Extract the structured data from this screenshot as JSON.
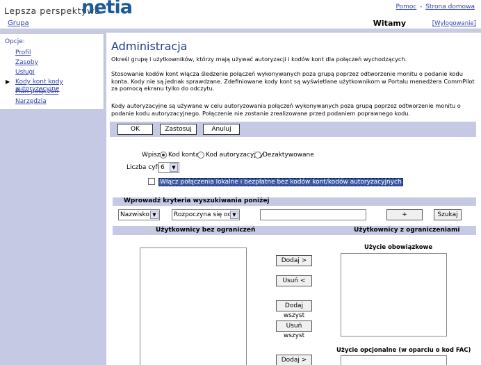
{
  "header": {
    "tagline": "Lepsza perspektywa",
    "brand": "netia",
    "help_link": "Pomoc",
    "separator": "-",
    "home_link": "Strona domowa",
    "group_link": "Grupa",
    "welcome": "Witamy",
    "logout": "[Wylogowanie]"
  },
  "sidebar": {
    "options_label": "Opcje:",
    "items": [
      {
        "label": "Profil"
      },
      {
        "label": "Zasoby"
      },
      {
        "label": "Usługi"
      },
      {
        "label": "Kody kont kody autoryzacyjne",
        "active": true
      },
      {
        "label": "Plan połączeń"
      },
      {
        "label": "Narzędzia"
      }
    ]
  },
  "main": {
    "title": "Administracja",
    "para1": "Określ grupę i użytkowników, którzy mają używać autoryzacji i kodów kont dla połączeń wychodzących.",
    "para2": "Stosowanie kodów kont włącza śledzenie połączeń wykonywanych poza grupą poprzez odtworzenie monitu o podanie kodu konta. Kody nie są jednak sprawdzane. Zdefiniowane kody kont są wyświetlane użytkownikom w Portalu menedżera CommPilot za pomocą ekranu tylko do odczytu.",
    "para3": "Kody autoryzacyjne są używane w celu autoryzowania połączeń wykonywanych poza grupą poprzez odtworzenie monitu o podanie kodu autoryzacyjnego. Połączenie nie zostanie zrealizowane przed podaniem poprawnego kodu."
  },
  "toolbar": {
    "ok": "OK",
    "apply": "Zastosuj",
    "cancel": "Anuluj"
  },
  "settings": {
    "enter_label": "Wpisz:",
    "radio_account": "Kod konta",
    "radio_auth": "Kod autoryzacyjny",
    "radio_disabled": "Dezaktywowane",
    "selected_radio": "Kod konta",
    "digits_label": "Liczba cyfr:",
    "digits_value": "6",
    "checkbox_label": "Włącz połączenia lokalne i bezpłatne bez kodów kont/kodów autoryzacyjnych",
    "checkbox_checked": false
  },
  "search": {
    "title": "Wprowadź kryteria wyszukiwania poniżej",
    "field_value": "Nazwisko",
    "mode_value": "Rozpoczyna się od",
    "text_value": "",
    "plus": "+",
    "search_button": "Szukaj"
  },
  "lists": {
    "left_header": "Użytkownicy bez ograniczeń",
    "right_header": "Użytkownicy z ograniczeniami",
    "mandatory_title": "Użycie obowiązkowe",
    "optional_title": "Użycie opcjonalne (w oparciu o kod FAC)",
    "add": "Dodaj >",
    "remove": "Usuń <",
    "add_all": "Dodaj wszyst",
    "remove_all": "Usuń wszyst",
    "add2": "Dodaj >"
  },
  "colors": {
    "band": "#c5c9e3",
    "title": "#1f3f8c",
    "brand": "#1c5a9c",
    "link": "#3344aa"
  }
}
